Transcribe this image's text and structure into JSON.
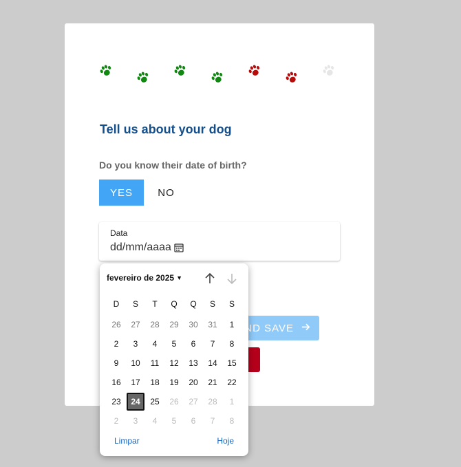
{
  "progress": {
    "paws": [
      {
        "icon": "paw-icon",
        "color": "#118811",
        "state": "done"
      },
      {
        "icon": "paw-icon",
        "color": "#118811",
        "state": "done"
      },
      {
        "icon": "paw-icon",
        "color": "#118811",
        "state": "done"
      },
      {
        "icon": "paw-icon",
        "color": "#118811",
        "state": "done"
      },
      {
        "icon": "paw-icon",
        "color": "#b50c0c",
        "state": "current"
      },
      {
        "icon": "paw-icon",
        "color": "#b50c0c",
        "state": "current"
      },
      {
        "icon": "paw-icon",
        "color": "#e6e6e6",
        "state": "pending"
      }
    ]
  },
  "form": {
    "title": "Tell us about your dog",
    "question": "Do you know their date of birth?",
    "yes_label": "YES",
    "no_label": "NO",
    "date_label": "Data",
    "date_value": "dd/mm/aaaa",
    "save_label": "ND SAVE"
  },
  "picker": {
    "month_label": "fevereiro de 2025",
    "weekdays": [
      "D",
      "S",
      "T",
      "Q",
      "Q",
      "S",
      "S"
    ],
    "weeks": [
      [
        {
          "d": "26",
          "t": "other"
        },
        {
          "d": "27",
          "t": "other"
        },
        {
          "d": "28",
          "t": "other"
        },
        {
          "d": "29",
          "t": "other"
        },
        {
          "d": "30",
          "t": "other"
        },
        {
          "d": "31",
          "t": "other"
        },
        {
          "d": "1",
          "t": "cur"
        }
      ],
      [
        {
          "d": "2",
          "t": "cur"
        },
        {
          "d": "3",
          "t": "cur"
        },
        {
          "d": "4",
          "t": "cur"
        },
        {
          "d": "5",
          "t": "cur"
        },
        {
          "d": "6",
          "t": "cur"
        },
        {
          "d": "7",
          "t": "cur"
        },
        {
          "d": "8",
          "t": "cur"
        }
      ],
      [
        {
          "d": "9",
          "t": "cur"
        },
        {
          "d": "10",
          "t": "cur"
        },
        {
          "d": "11",
          "t": "cur"
        },
        {
          "d": "12",
          "t": "cur"
        },
        {
          "d": "13",
          "t": "cur"
        },
        {
          "d": "14",
          "t": "cur"
        },
        {
          "d": "15",
          "t": "cur"
        }
      ],
      [
        {
          "d": "16",
          "t": "cur"
        },
        {
          "d": "17",
          "t": "cur"
        },
        {
          "d": "18",
          "t": "cur"
        },
        {
          "d": "19",
          "t": "cur"
        },
        {
          "d": "20",
          "t": "cur"
        },
        {
          "d": "21",
          "t": "cur"
        },
        {
          "d": "22",
          "t": "cur"
        }
      ],
      [
        {
          "d": "23",
          "t": "cur"
        },
        {
          "d": "24",
          "t": "selected"
        },
        {
          "d": "25",
          "t": "cur"
        },
        {
          "d": "26",
          "t": "faded"
        },
        {
          "d": "27",
          "t": "faded"
        },
        {
          "d": "28",
          "t": "faded"
        },
        {
          "d": "1",
          "t": "faded"
        }
      ],
      [
        {
          "d": "2",
          "t": "faded"
        },
        {
          "d": "3",
          "t": "faded"
        },
        {
          "d": "4",
          "t": "faded"
        },
        {
          "d": "5",
          "t": "faded"
        },
        {
          "d": "6",
          "t": "faded"
        },
        {
          "d": "7",
          "t": "faded"
        },
        {
          "d": "8",
          "t": "faded"
        }
      ]
    ],
    "clear_label": "Limpar",
    "today_label": "Hoje"
  }
}
